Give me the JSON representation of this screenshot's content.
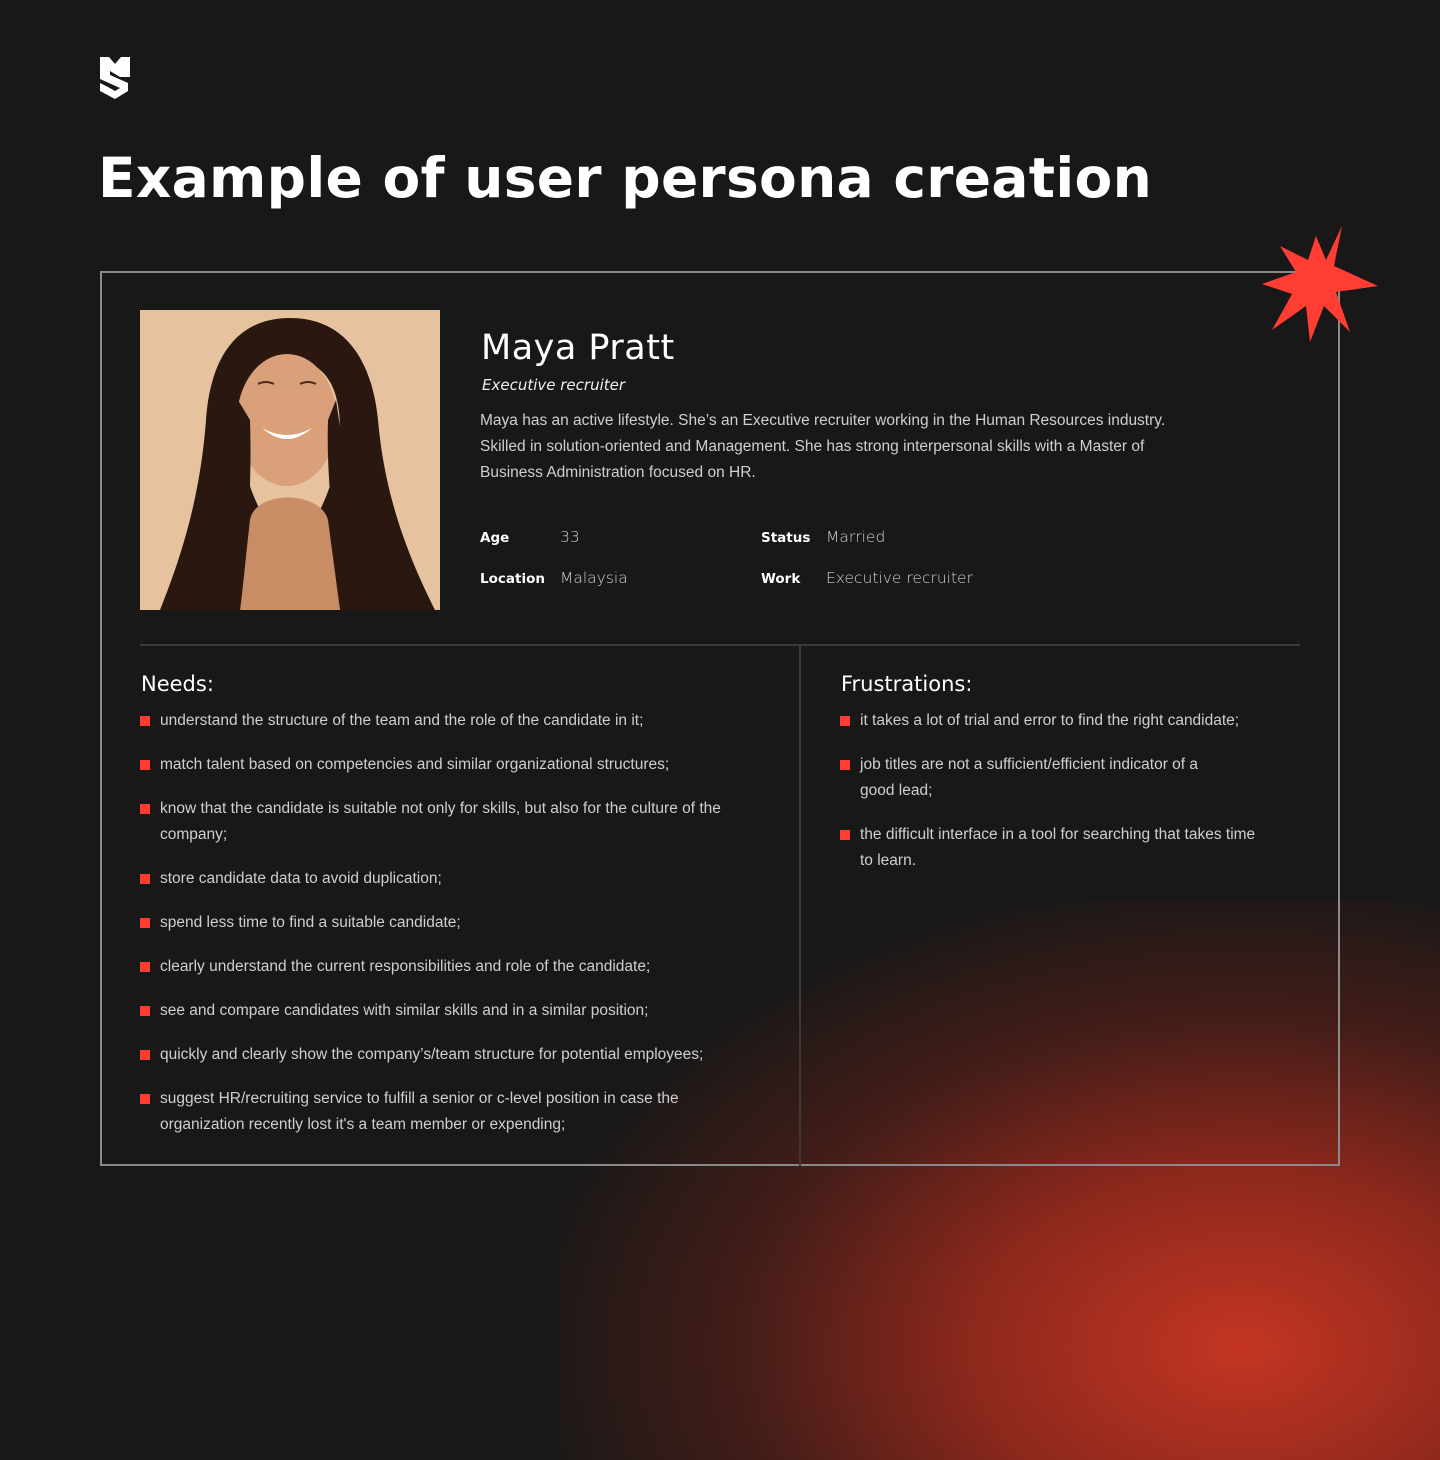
{
  "brand": {
    "logo_icon": "shield-s-logo-icon",
    "accent_color": "#ff3d33"
  },
  "page": {
    "title": "Example of user persona creation"
  },
  "persona": {
    "photo_icon": "persona-portrait-photo",
    "name": "Maya Pratt",
    "role": "Executive recruiter",
    "bio": "Maya has an active lifestyle. She’s an Executive recruiter working in the Human Resources industry. Skilled in solution-oriented and Management. She has strong interpersonal skills with a Master of Business Administration focused on HR.",
    "facts": [
      {
        "label": "Age",
        "value": "33"
      },
      {
        "label": "Location",
        "value": "Malaysia"
      },
      {
        "label": "Status",
        "value": "Married"
      },
      {
        "label": "Work",
        "value": "Executive recruiter"
      }
    ]
  },
  "needs": {
    "title": "Needs:",
    "items": [
      "understand the structure of the team and the role of the candidate in it;",
      "match talent based on competencies and similar organizational structures;",
      "know that the candidate is suitable not only for skills, but also for the culture of the company;",
      "store candidate data to avoid duplication;",
      "spend less time to find a suitable candidate;",
      "clearly understand the current responsibilities and role of the candidate;",
      "see and compare candidates with similar skills and in a similar position;",
      "quickly and clearly show the company’s/team structure for potential employees;",
      "suggest HR/recruiting service to fulfill a senior or c-level position in case the organization recently lost it's a team member or expending;"
    ]
  },
  "frustrations": {
    "title": "Frustrations:",
    "items": [
      "it takes a lot of trial and error to find the right candidate;",
      "job titles are not a sufficient/efficient indicator of a good lead;",
      "the difficult interface in a tool for searching that takes time to learn."
    ]
  }
}
